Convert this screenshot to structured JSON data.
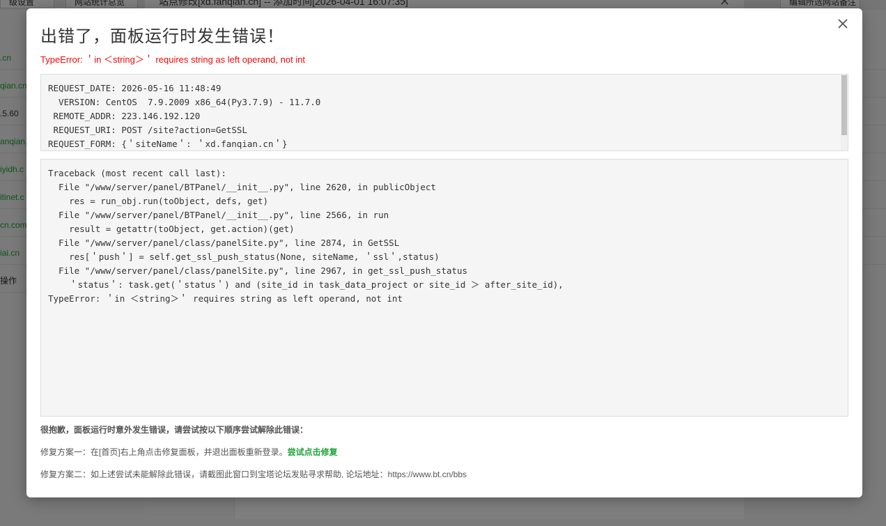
{
  "background": {
    "tabs": [
      "级设置",
      "网站统计总览"
    ],
    "inner_modal_title": "站点修改[xd.fanqian.cn] -- 添加时间[2026-04-01 16:07:35]",
    "left_column_items": [
      ".cn",
      "qian.cn",
      ".5.60",
      "anqian.",
      "iyidh.c",
      "itinet.c",
      "cn.com",
      "iai.cn",
      "操作"
    ],
    "right_top_text": "编辑所选网站备注"
  },
  "dialog": {
    "title": "出错了，面板运行时发生错误！",
    "error_summary": "TypeError: ＇in ＜string＞＇ requires string as left operand, not int",
    "request_info": [
      "REQUEST_DATE: 2026-05-16 11:48:49",
      "  VERSION: CentOS  7.9.2009 x86_64(Py3.7.9) - 11.7.0",
      " REMOTE_ADDR: 223.146.192.120",
      " REQUEST_URI: POST /site?action=GetSSL",
      "REQUEST_FORM: {＇siteName＇: ＇xd.fanqian.cn＇}"
    ],
    "traceback": [
      "Traceback (most recent call last):",
      "  File \"/www/server/panel/BTPanel/__init__.py\", line 2620, in publicObject",
      "    res = run_obj.run(toObject, defs, get)",
      "  File \"/www/server/panel/BTPanel/__init__.py\", line 2566, in run",
      "    result = getattr(toObject, get.action)(get)",
      "  File \"/www/server/panel/class/panelSite.py\", line 2874, in GetSSL",
      "    res[＇push＇] = self.get_ssl_push_status(None, siteName, ＇ssl＇,status)",
      "  File \"/www/server/panel/class/panelSite.py\", line 2967, in get_ssl_push_status",
      "    ＇status＇: task.get(＇status＇) and (site_id in task_data_project or site_id ＞ after_site_id),",
      "TypeError: ＇in ＜string＞＇ requires string as left operand, not int"
    ],
    "sorry_text": "很抱歉，面板运行时意外发生错误，请尝试按以下顺序尝试解除此错误：",
    "fix1_text": "修复方案一：在[首页]右上角点击修复面板，并退出面板重新登录。",
    "fix1_link": "尝试点击修复",
    "fix2_text": "修复方案二：如上述尝试未能解除此错误，请截图此窗口到宝塔论坛发贴寻求帮助, 论坛地址：https://www.bt.cn/bbs"
  },
  "colors": {
    "error_red": "#ef0808",
    "link_green": "#20a53a"
  },
  "icons": {
    "close": "close-icon"
  }
}
